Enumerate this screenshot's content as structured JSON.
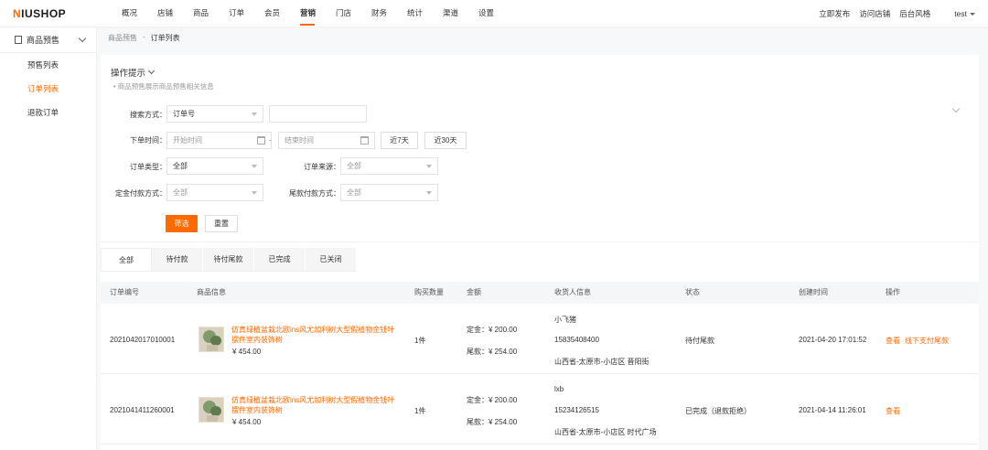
{
  "logo": {
    "prefix": "N",
    "text": "IUSHOP"
  },
  "nav": [
    "概况",
    "店铺",
    "商品",
    "订单",
    "会员",
    "营销",
    "门店",
    "财务",
    "统计",
    "渠道",
    "设置"
  ],
  "nav_active_index": 5,
  "top_right": {
    "publish": "立即发布",
    "visit_store": "访问店铺",
    "admin_style": "后台风格",
    "user": "test"
  },
  "sidebar": {
    "group_label": "商品预售",
    "items": [
      {
        "label": "预售列表",
        "active": false
      },
      {
        "label": "订单列表",
        "active": true
      },
      {
        "label": "退款订单",
        "active": false
      }
    ]
  },
  "breadcrumb": {
    "parent": "商品预售",
    "sep": "-",
    "current": "订单列表"
  },
  "tips": {
    "title": "操作提示",
    "body": "• 商品预售展示商品预售相关信息"
  },
  "filters": {
    "search_label": "搜索方式：",
    "search_type": "订单号",
    "order_time_label": "下单时间：",
    "start_placeholder": "开始时间",
    "end_placeholder": "结束时间",
    "range_sep": "-",
    "btn_7days": "近7天",
    "btn_30days": "近30天",
    "order_type_label": "订单类型：",
    "order_type_value": "全部",
    "order_source_label": "订单来源：",
    "order_source_value": "全部",
    "deposit_pay_label": "定金付款方式：",
    "deposit_pay_value": "全部",
    "final_pay_label": "尾款付款方式：",
    "final_pay_value": "全部",
    "filter_btn": "筛选",
    "reset_btn": "重置"
  },
  "tabs": [
    {
      "label": "全部",
      "active": true
    },
    {
      "label": "待付款",
      "active": false
    },
    {
      "label": "待付尾款",
      "active": false
    },
    {
      "label": "已完成",
      "active": false
    },
    {
      "label": "已关闭",
      "active": false
    }
  ],
  "table": {
    "headers": {
      "order_no": "订单编号",
      "product": "商品信息",
      "qty": "购买数量",
      "amount": "金额",
      "receiver": "收货人信息",
      "status": "状态",
      "created": "创建时间",
      "actions": "操作"
    },
    "rows": [
      {
        "order_no": "2021042017010001",
        "product_name": "仿真绿植盆栽北欧ins风尤加利树大型假植物金钱叶摆件室内装饰树",
        "product_price": "¥ 454.00",
        "qty": "1件",
        "deposit": "定金：¥ 200.00",
        "final": "尾款：¥ 254.00",
        "receiver_name": "小飞猪",
        "receiver_phone": "15835408400",
        "receiver_addr": "山西省-太原市-小店区 晋阳街",
        "status": "待付尾款",
        "created": "2021-04-20 17:01:52",
        "actions": [
          "查看",
          "线下支付尾款"
        ]
      },
      {
        "order_no": "2021041411260001",
        "product_name": "仿真绿植盆栽北欧ins风尤加利树大型假植物金钱叶摆件室内装饰树",
        "product_price": "¥ 454.00",
        "qty": "1件",
        "deposit": "定金：¥ 200.00",
        "final": "尾款：¥ 254.00",
        "receiver_name": "lxb",
        "receiver_phone": "15234126515",
        "receiver_addr": "山西省-太原市-小店区 时代广场",
        "status": "已完成（退款拒绝）",
        "created": "2021-04-14 11:26:01",
        "actions": [
          "查看"
        ]
      }
    ]
  },
  "colors": {
    "accent": "#ff6a00"
  }
}
